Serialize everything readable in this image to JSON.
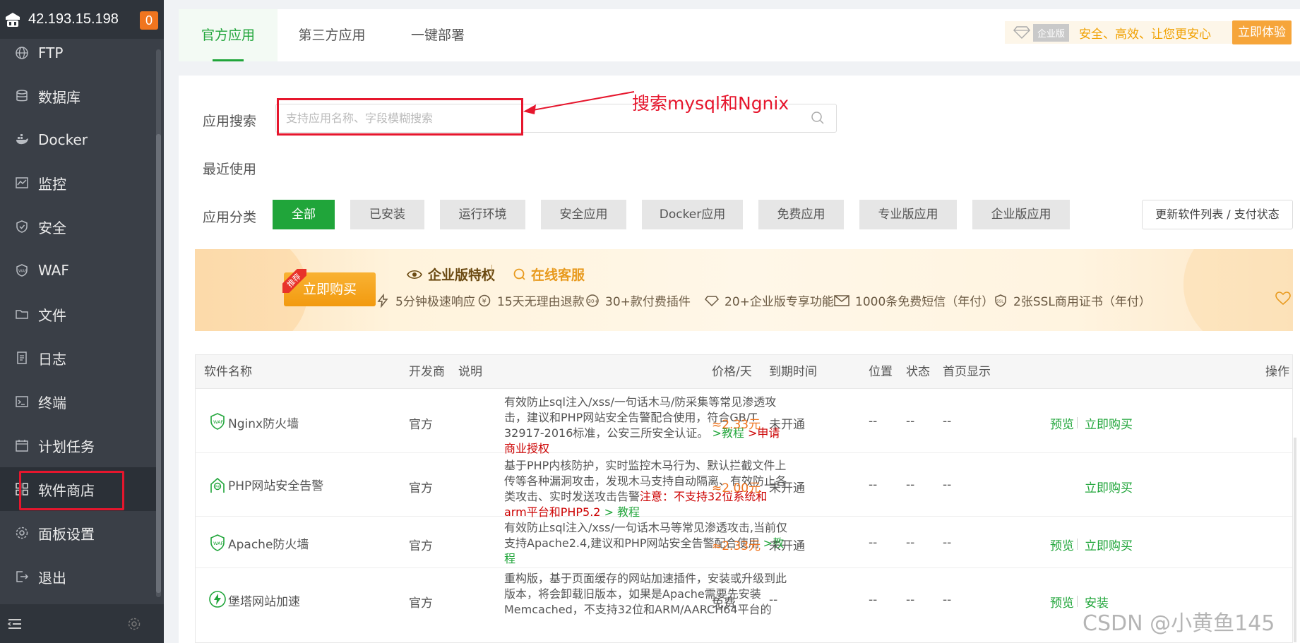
{
  "sidebar": {
    "ip": "42.193.15.198",
    "badge": "0",
    "items": [
      {
        "label": "FTP",
        "icon": "globe-icon"
      },
      {
        "label": "数据库",
        "icon": "database-icon"
      },
      {
        "label": "Docker",
        "icon": "docker-icon"
      },
      {
        "label": "监控",
        "icon": "monitor-chart-icon"
      },
      {
        "label": "安全",
        "icon": "shield-icon"
      },
      {
        "label": "WAF",
        "icon": "waf-shield-icon"
      },
      {
        "label": "文件",
        "icon": "folder-icon"
      },
      {
        "label": "日志",
        "icon": "log-icon"
      },
      {
        "label": "终端",
        "icon": "terminal-icon"
      },
      {
        "label": "计划任务",
        "icon": "calendar-icon"
      },
      {
        "label": "软件商店",
        "icon": "grid-apps-icon"
      },
      {
        "label": "面板设置",
        "icon": "gear-icon"
      },
      {
        "label": "退出",
        "icon": "logout-icon"
      }
    ]
  },
  "tabs": [
    {
      "label": "官方应用",
      "active": true
    },
    {
      "label": "第三方应用",
      "active": false
    },
    {
      "label": "一键部署",
      "active": false
    }
  ],
  "enterprise": {
    "tag": "企业版",
    "slogan": "安全、高效、让您更安心",
    "button": "立即体验"
  },
  "search": {
    "label": "应用搜索",
    "placeholder": "支持应用名称、字段模糊搜索",
    "annotation": "搜索mysql和Ngnix"
  },
  "recent_label": "最近使用",
  "category": {
    "label": "应用分类",
    "items": [
      "全部",
      "已安装",
      "运行环境",
      "安全应用",
      "Docker应用",
      "免费应用",
      "专业版应用",
      "企业版应用"
    ],
    "update_button": "更新软件列表 / 支付状态"
  },
  "banner": {
    "ribbon": "推荐",
    "buy": "立即购买",
    "privilege": "企业版特权",
    "support": "在线客服",
    "features": [
      "5分钟极速响应",
      "15天无理由退款",
      "30+款付费插件",
      "20+企业版专享功能",
      "1000条免费短信（年付）",
      "2张SSL商用证书（年付）"
    ]
  },
  "table": {
    "headers": [
      "软件名称",
      "开发商",
      "说明",
      "价格/天",
      "到期时间",
      "位置",
      "状态",
      "首页显示",
      "操作"
    ],
    "rows": [
      {
        "name": "Nginx防火墙",
        "vendor": "官方",
        "desc": "有效防止sql注入/xss/一句话木马/防采集等常见渗透攻击，建议和PHP网站安全告警配合使用，符合GB/T 32917-2016标准，公安三所安全认证。",
        "desc_link1": ">教程",
        "desc_link2": ">申请商业授权",
        "price": "≈2.33元",
        "expire": "未开通",
        "location": "--",
        "status": "--",
        "homepage": "--",
        "preview": "预览",
        "buy": "立即购买"
      },
      {
        "name": "PHP网站安全告警",
        "vendor": "官方",
        "desc": "基于PHP内核防护，实时监控木马行为、默认拦截文件上传等各种漏洞攻击，发现木马支持自动隔离、有效防止各类攻击、实时发送攻击告警",
        "desc_warn": "注意：不支持32位系统和arm平台和PHP5.2",
        "desc_link1": "> 教程",
        "price": "≈2.00元",
        "expire": "未开通",
        "location": "--",
        "status": "--",
        "homepage": "--",
        "buy": "立即购买"
      },
      {
        "name": "Apache防火墙",
        "vendor": "官方",
        "desc": "有效防止sql注入/xss/一句话木马等常见渗透攻击,当前仅支持Apache2.4,建议和PHP网站安全告警配合使用",
        "desc_link1": ">教程",
        "price": "≈2.33元",
        "expire": "未开通",
        "location": "--",
        "status": "--",
        "homepage": "--",
        "preview": "预览",
        "buy": "立即购买"
      },
      {
        "name": "堡塔网站加速",
        "vendor": "官方",
        "desc": "重构版，基于页面缓存的网站加速插件，安装或升级到此版本，将会卸载旧版本，如果是Apache需要先安装Memcached，不支持32位和ARM/AARCH64平台的",
        "price": "免费",
        "expire": "--",
        "location": "--",
        "status": "--",
        "homepage": "--",
        "preview": "预览",
        "buy": "安装"
      }
    ]
  },
  "watermark": "CSDN @小黄鱼145",
  "colors": {
    "accent": "#20a53a",
    "annotation": "#e6162d",
    "sidebar": "#3a3f47",
    "price": "#f0751f"
  }
}
